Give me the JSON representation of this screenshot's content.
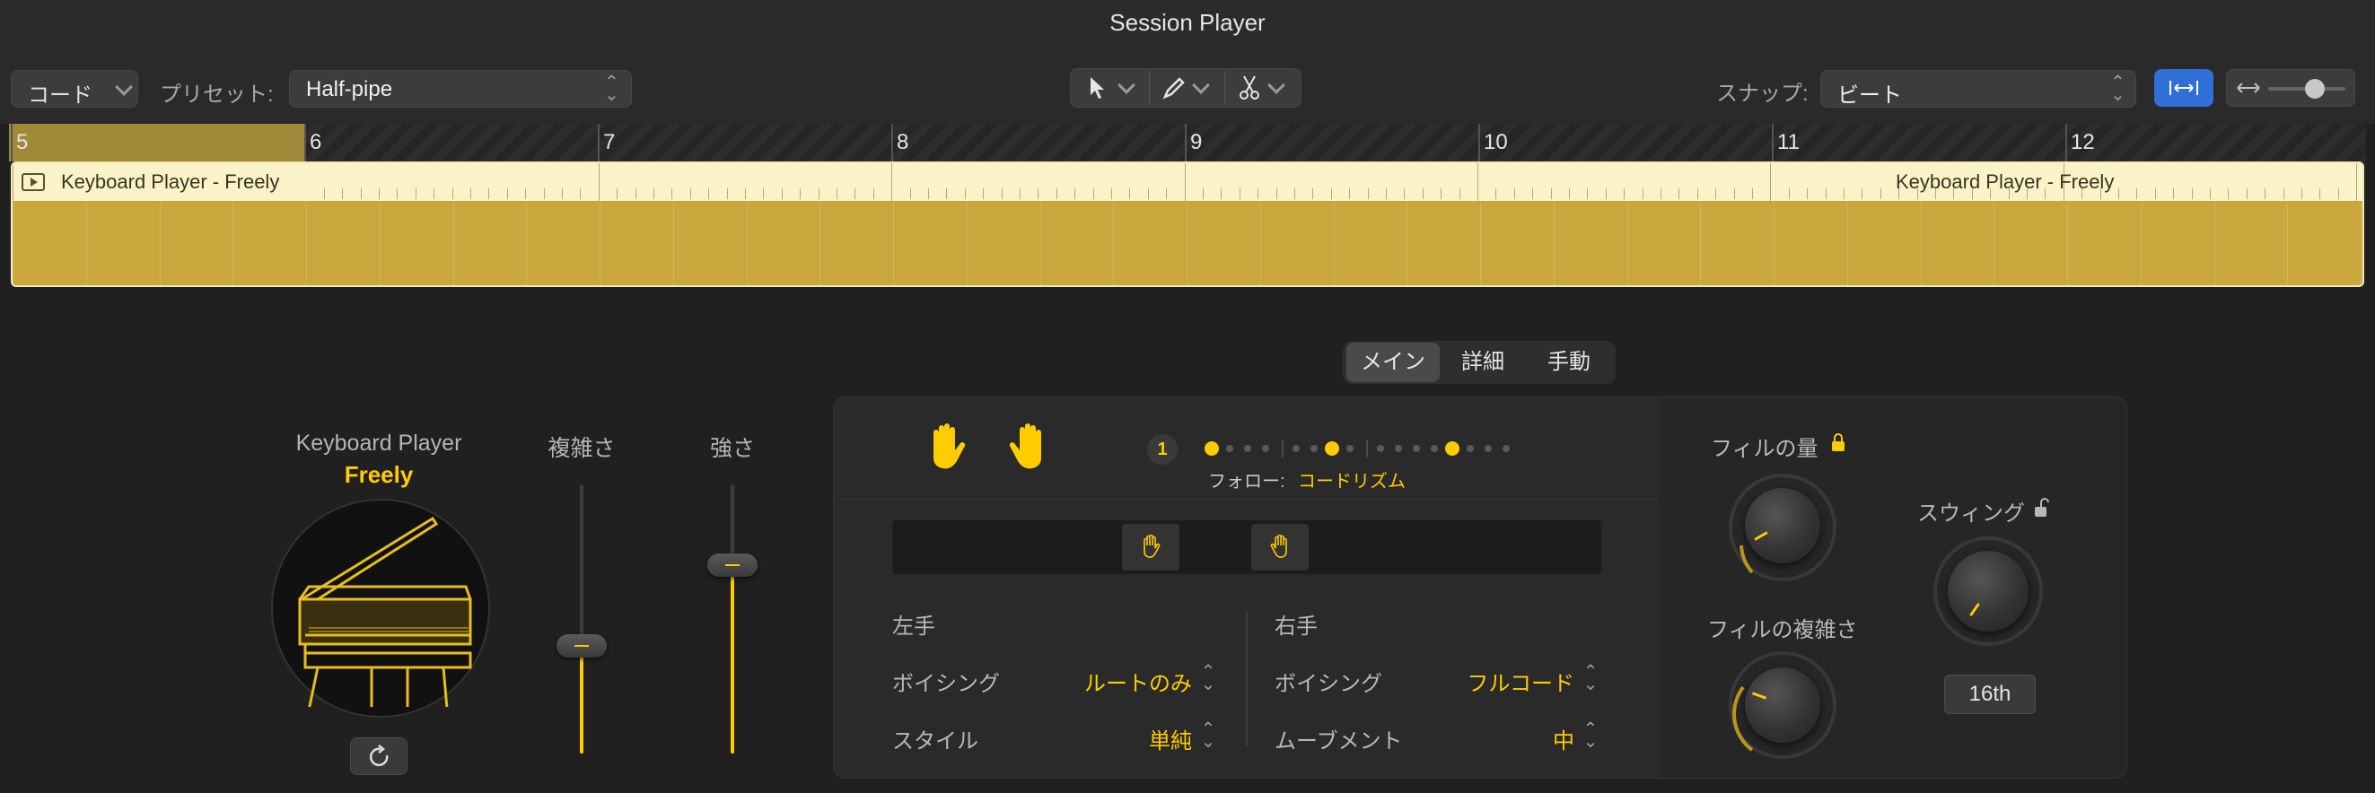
{
  "window": {
    "title": "Session Player"
  },
  "toolbar": {
    "mode_select": "コード",
    "preset_label": "プリセット:",
    "preset_value": "Half-pipe",
    "snap_label": "スナップ:",
    "snap_value": "ビート",
    "tools": [
      "pointer-icon",
      "pencil-icon",
      "scissors-icon"
    ],
    "zoom_level": 0.6
  },
  "timeline": {
    "bars": [
      "5",
      "6",
      "7",
      "8",
      "9",
      "10",
      "11",
      "12"
    ],
    "region_label_start": "Keyboard Player - Freely",
    "region_label_end": "Keyboard Player - Freely",
    "region_color": "#c9a73d"
  },
  "tabs": [
    "メイン",
    "詳細",
    "手動"
  ],
  "active_tab": "メイン",
  "player": {
    "name": "Keyboard Player",
    "style": "Freely",
    "accent": "#ffcc00"
  },
  "sliders": {
    "complexity": {
      "label": "複雑さ",
      "value": 0.4
    },
    "intensity": {
      "label": "強さ",
      "value": 0.7
    }
  },
  "follow": {
    "beat_number": "1",
    "label": "フォロー:",
    "value": "コードリズム"
  },
  "left_hand": {
    "heading": "左手",
    "voicing_label": "ボイシング",
    "voicing_value": "ルートのみ",
    "style_label": "スタイル",
    "style_value": "単純"
  },
  "right_hand": {
    "heading": "右手",
    "voicing_label": "ボイシング",
    "voicing_value": "フルコード",
    "movement_label": "ムーブメント",
    "movement_value": "中"
  },
  "fill": {
    "amount_label": "フィルの量",
    "complexity_label": "フィルの複雑さ"
  },
  "swing": {
    "label": "スウィング",
    "value_label": "16th"
  }
}
